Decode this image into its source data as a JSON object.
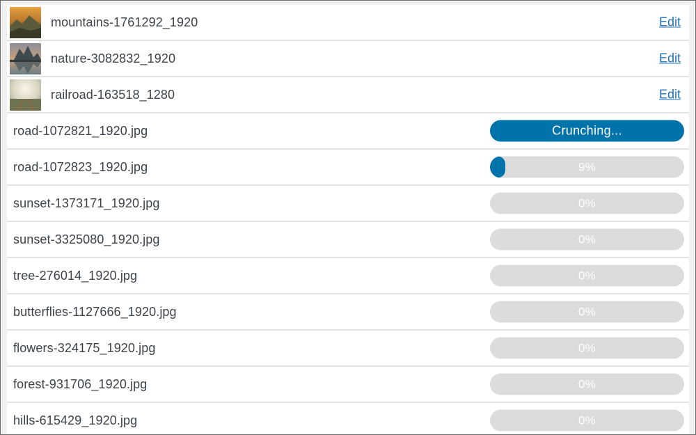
{
  "colors": {
    "accent": "#0073aa",
    "link": "#2271b1",
    "track": "#dcdcdc",
    "text": "#3c434a"
  },
  "optimized_files": [
    {
      "name": "mountains-1761292_1920",
      "action": "Edit",
      "thumbnail": "mountain-sunset-thumbnail"
    },
    {
      "name": "nature-3082832_1920",
      "action": "Edit",
      "thumbnail": "lake-reflection-thumbnail"
    },
    {
      "name": "railroad-163518_1280",
      "action": "Edit",
      "thumbnail": "railroad-thumbnail"
    }
  ],
  "queue": [
    {
      "name": "road-1072821_1920.jpg",
      "status": "Crunching...",
      "progress": null
    },
    {
      "name": "road-1072823_1920.jpg",
      "status": "9%",
      "progress": 0.09
    },
    {
      "name": "sunset-1373171_1920.jpg",
      "status": "0%",
      "progress": 0
    },
    {
      "name": "sunset-3325080_1920.jpg",
      "status": "0%",
      "progress": 0
    },
    {
      "name": "tree-276014_1920.jpg",
      "status": "0%",
      "progress": 0
    },
    {
      "name": "butterflies-1127666_1920.jpg",
      "status": "0%",
      "progress": 0
    },
    {
      "name": "flowers-324175_1920.jpg",
      "status": "0%",
      "progress": 0
    },
    {
      "name": "forest-931706_1920.jpg",
      "status": "0%",
      "progress": 0
    },
    {
      "name": "hills-615429_1920.jpg",
      "status": "0%",
      "progress": 0
    }
  ]
}
